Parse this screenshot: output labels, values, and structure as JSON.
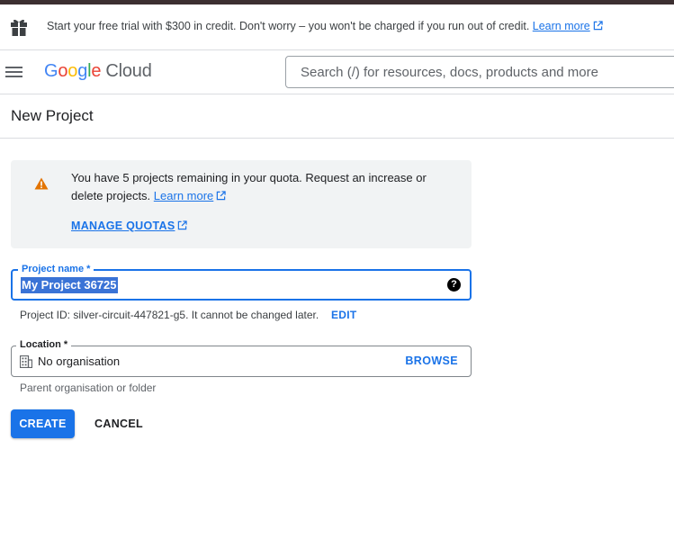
{
  "trial_banner": {
    "text": "Start your free trial with $300 in credit. Don't worry – you won't be charged if you run out of credit.",
    "link": "Learn more"
  },
  "header": {
    "logo_letters": [
      "G",
      "o",
      "o",
      "g",
      "l",
      "e"
    ],
    "logo_product": "Cloud",
    "search_placeholder": "Search (/) for resources, docs, products and more"
  },
  "page": {
    "title": "New Project"
  },
  "notice": {
    "text": "You have 5 projects remaining in your quota. Request an increase or delete projects.",
    "learn_more": "Learn more",
    "manage_quotas": "MANAGE QUOTAS"
  },
  "project_name": {
    "label": "Project name *",
    "value": "My Project 36725",
    "help_icon": "?"
  },
  "project_id": {
    "prefix": "Project ID: ",
    "id": "silver-circuit-447821-g5",
    "suffix": ". It cannot be changed later.",
    "edit": "EDIT"
  },
  "location": {
    "label": "Location *",
    "value": "No organisation",
    "browse": "BROWSE",
    "hint": "Parent organisation or folder"
  },
  "actions": {
    "create": "CREATE",
    "cancel": "CANCEL"
  },
  "colors": {
    "accent": "#1a73e8",
    "warning": "#e37400",
    "top_stripe": "#3c2f31"
  },
  "icons": {
    "gift": "gift-icon",
    "menu": "hamburger-menu-icon",
    "warning": "warning-triangle-icon",
    "external": "external-link-icon",
    "help": "help-circle-icon",
    "organisation": "building-icon"
  }
}
